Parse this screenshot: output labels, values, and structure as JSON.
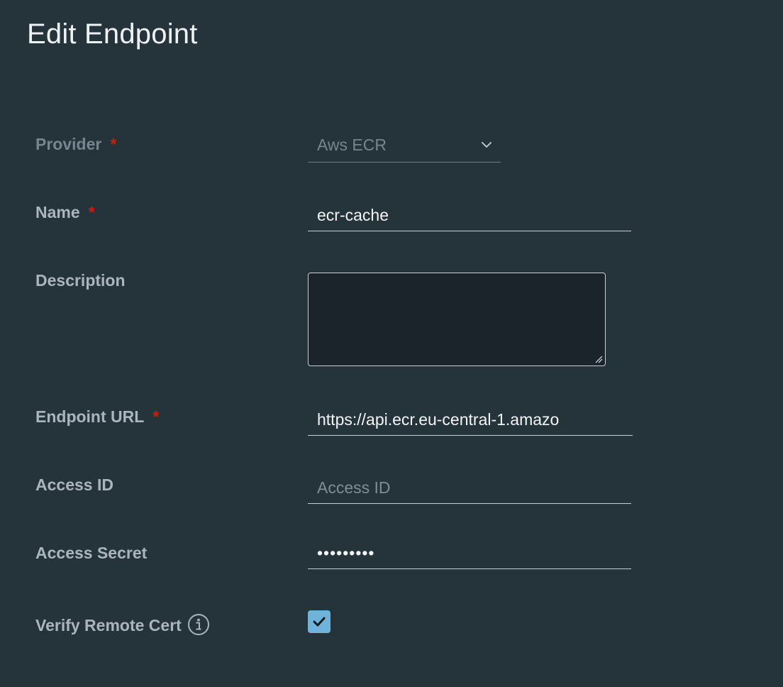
{
  "page": {
    "title": "Edit Endpoint"
  },
  "form": {
    "provider": {
      "label": "Provider",
      "required": "*",
      "value": "Aws ECR"
    },
    "name": {
      "label": "Name",
      "required": "*",
      "value": "ecr-cache"
    },
    "description": {
      "label": "Description",
      "value": ""
    },
    "endpoint_url": {
      "label": "Endpoint URL",
      "required": "*",
      "value": "https://api.ecr.eu-central-1.amazo"
    },
    "access_id": {
      "label": "Access ID",
      "placeholder": "Access ID",
      "value": ""
    },
    "access_secret": {
      "label": "Access Secret",
      "value": "•••••••••"
    },
    "verify_remote_cert": {
      "label": "Verify Remote Cert",
      "checked": true,
      "info_icon": "info-circle-icon"
    }
  },
  "colors": {
    "background": "#25333b",
    "required_asterisk": "#c92100",
    "checkbox_fill": "#6fb2da"
  }
}
